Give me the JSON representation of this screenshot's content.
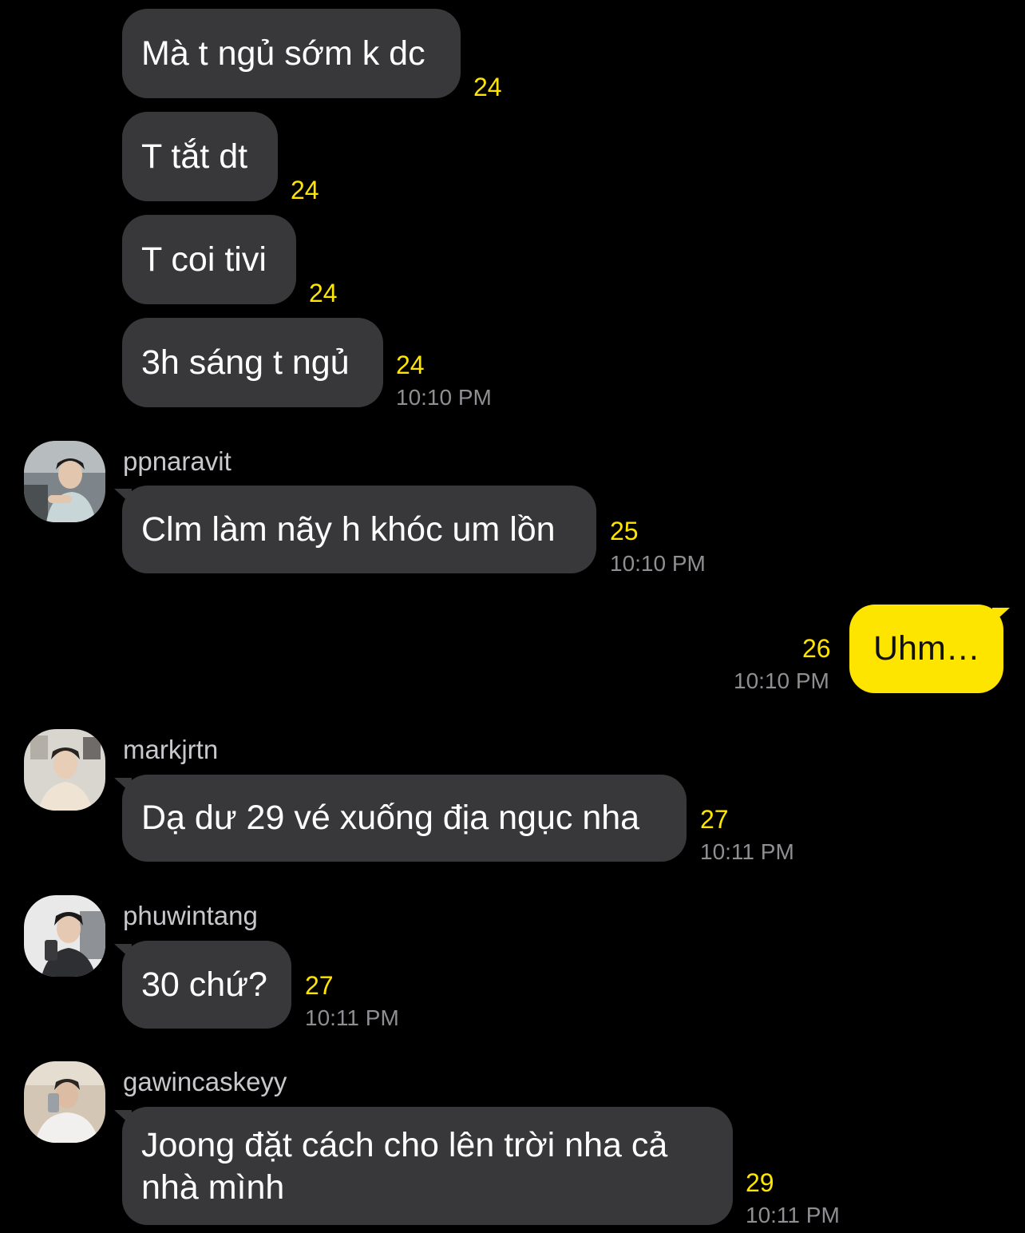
{
  "colors": {
    "background": "#000000",
    "incoming_bubble": "#38383a",
    "outgoing_bubble": "#fee500",
    "unread_count": "#fee500",
    "timestamp": "#8e8e93",
    "sender_name": "#c7c7cc"
  },
  "messages": [
    {
      "text": "Mà t ngủ sớm k dc",
      "count": "24",
      "time": ""
    },
    {
      "text": "T tắt dt",
      "count": "24",
      "time": ""
    },
    {
      "text": "T coi tivi",
      "count": "24",
      "time": ""
    },
    {
      "text": "3h sáng t ngủ",
      "count": "24",
      "time": "10:10 PM"
    },
    {
      "sender": "ppnaravit",
      "avatar": "avatar-ppnaravit",
      "text": "Clm làm nãy h khóc um lồn",
      "count": "25",
      "time": "10:10 PM"
    },
    {
      "sender": "me",
      "text": "Uhm…",
      "count": "26",
      "time": "10:10 PM"
    },
    {
      "sender": "markjrtn",
      "avatar": "avatar-markjrtn",
      "text": "Dạ dư 29 vé xuống địa ngục nha",
      "count": "27",
      "time": "10:11 PM"
    },
    {
      "sender": "phuwintang",
      "avatar": "avatar-phuwintang",
      "text": "30 chứ?",
      "count": "27",
      "time": "10:11 PM"
    },
    {
      "sender": "gawincaskeyy",
      "avatar": "avatar-gawincaskeyy",
      "text": "Joong đặt cách cho lên trời nha cả nhà mình",
      "count": "29",
      "time": "10:11 PM"
    }
  ]
}
